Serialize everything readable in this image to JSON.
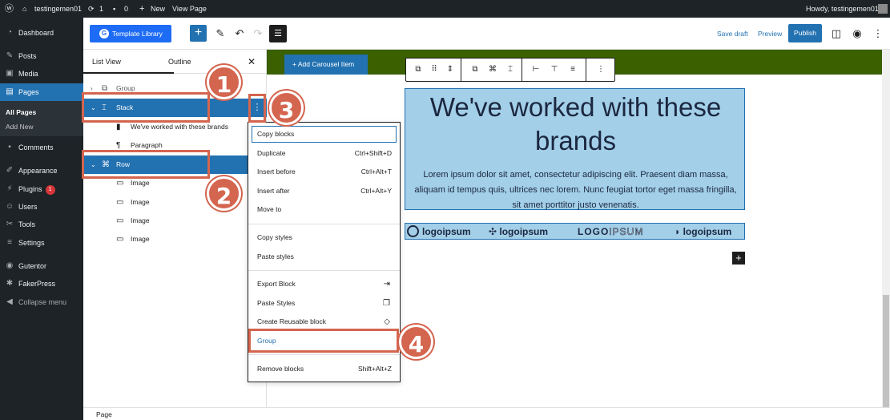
{
  "adminbar": {
    "site_name": "testingemen01",
    "updates": "1",
    "comments": "0",
    "new_label": "New",
    "view_page": "View Page",
    "howdy": "Howdy, testingemen01"
  },
  "sidebar": {
    "dashboard": "Dashboard",
    "posts": "Posts",
    "media": "Media",
    "pages": "Pages",
    "all_pages": "All Pages",
    "add_new": "Add New",
    "comments": "Comments",
    "appearance": "Appearance",
    "plugins": "Plugins",
    "plugins_badge": "1",
    "users": "Users",
    "tools": "Tools",
    "settings": "Settings",
    "gutentor": "Gutentor",
    "fakerpress": "FakerPress",
    "collapse": "Collapse menu"
  },
  "header": {
    "template_library": "Template Library",
    "save_draft": "Save draft",
    "preview": "Preview",
    "publish": "Publish"
  },
  "listview": {
    "tab_list": "List View",
    "tab_outline": "Outline",
    "rows": {
      "group": "Group",
      "stack": "Stack",
      "heading": "We've worked with these brands",
      "paragraph": "Paragraph",
      "row": "Row",
      "image1": "Image",
      "image2": "Image",
      "image3": "Image",
      "image4": "Image"
    }
  },
  "canvas": {
    "carousel_button": "Add Carousel Item",
    "heading": "We've worked with these brands",
    "paragraph": "Lorem ipsum dolor sit amet, consectetur adipiscing elit. Praesent diam massa, aliquam id tempus quis, ultrices nec lorem. Nunc feugiat tortor eget massa fringilla, sit amet porttitor justo venenatis.",
    "logos": {
      "l1": "logoipsum",
      "l2": "logoipsum",
      "l3a": "LOGO",
      "l3b": "IPSUM",
      "l4": "logoipsum"
    }
  },
  "context_menu": {
    "copy_blocks": "Copy blocks",
    "duplicate": "Duplicate",
    "duplicate_sc": "Ctrl+Shift+D",
    "insert_before": "Insert before",
    "insert_before_sc": "Ctrl+Alt+T",
    "insert_after": "Insert after",
    "insert_after_sc": "Ctrl+Alt+Y",
    "move_to": "Move to",
    "copy_styles": "Copy styles",
    "paste_styles": "Paste styles",
    "export_block": "Export Block",
    "paste_styles2": "Paste Styles",
    "create_reusable": "Create Reusable block",
    "group": "Group",
    "remove_blocks": "Remove blocks",
    "remove_sc": "Shift+Alt+Z"
  },
  "footer": {
    "breadcrumb": "Page"
  },
  "annotations": {
    "n1": "1",
    "n2": "2",
    "n3": "3",
    "n4": "4"
  },
  "colors": {
    "admin_dark": "#1d2327",
    "wp_blue": "#2271b1",
    "annotation": "#d4654f",
    "green": "#3a6000",
    "block_bg": "#a3cfe8"
  }
}
